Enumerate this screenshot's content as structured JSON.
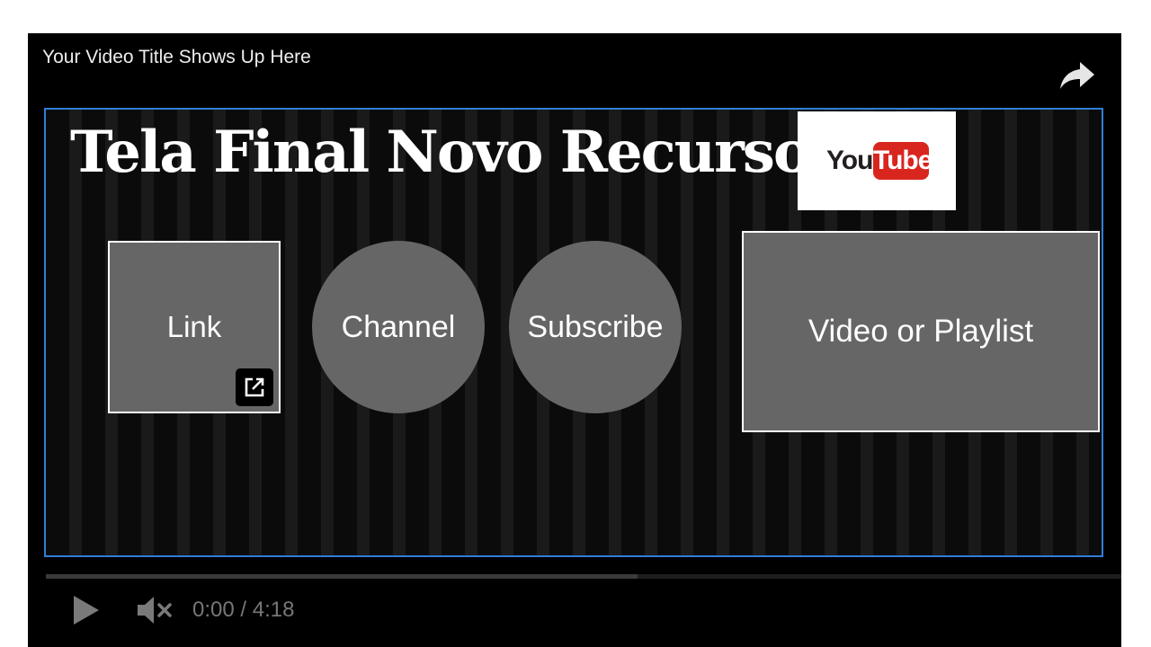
{
  "player": {
    "video_title": "Your Video Title Shows Up Here",
    "icons": {
      "share": "share-icon",
      "play": "play-icon",
      "mute": "volume-muted-icon",
      "external_link": "external-link-icon"
    }
  },
  "endscreen": {
    "promo_title": "Tela Final Novo Recurso",
    "logo": {
      "you": "You",
      "tube": "Tube"
    },
    "elements": {
      "link": "Link",
      "channel": "Channel",
      "subscribe": "Subscribe",
      "video_playlist": "Video or Playlist"
    },
    "border_color": "#2f7fd6"
  },
  "controls": {
    "time": "0:00 / 4:18",
    "progress_fraction": 0.55
  },
  "colors": {
    "youtube_red": "#d8261f",
    "element_gray": "#666666"
  }
}
